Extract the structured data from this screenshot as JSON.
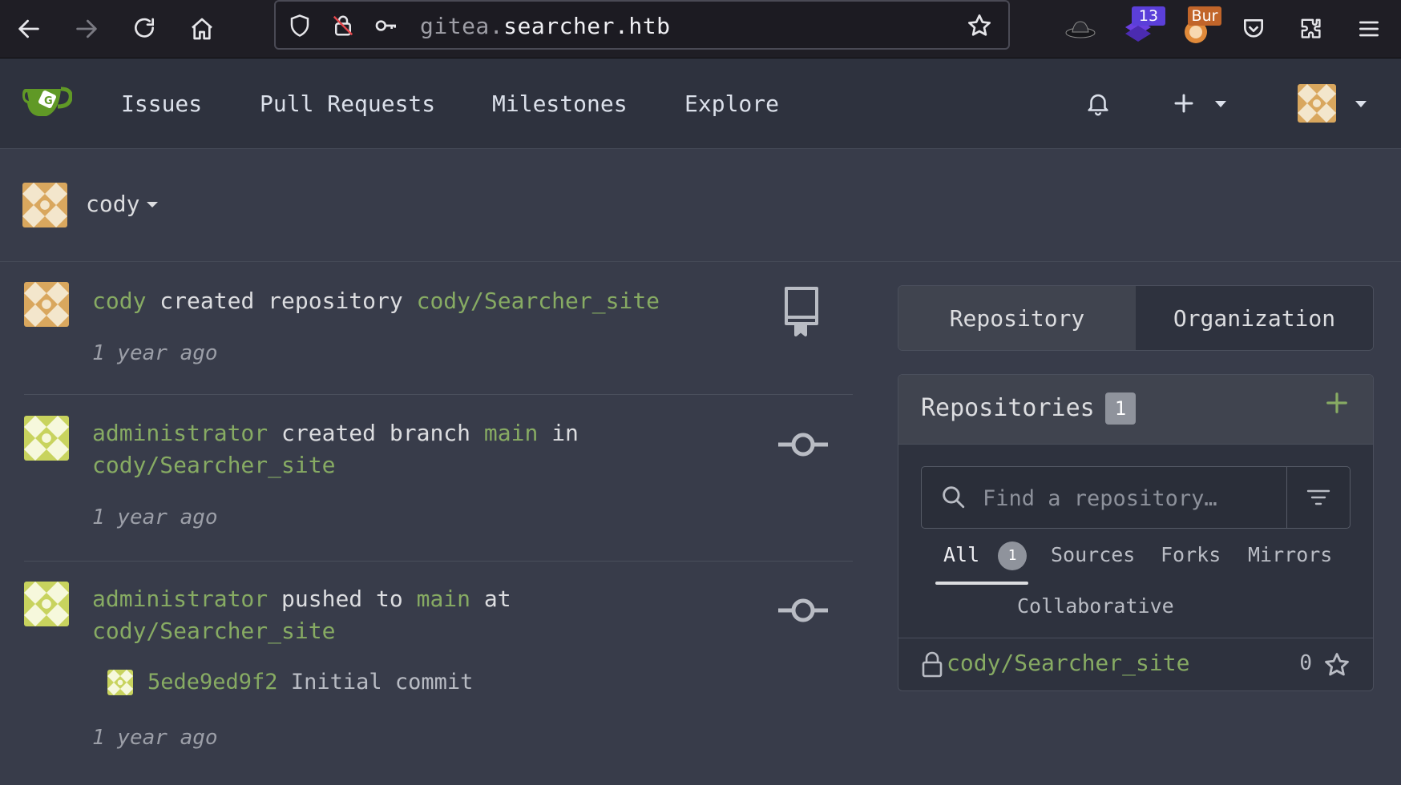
{
  "browser": {
    "url_subdomain": "gitea.",
    "url_host": "searcher.htb",
    "extensions": [
      {
        "name": "hat-icon"
      },
      {
        "name": "stack-extension-icon",
        "badge": "13"
      },
      {
        "name": "burp-extension-icon",
        "badge": "Bur"
      },
      {
        "name": "pocket-icon"
      },
      {
        "name": "extensions-icon"
      },
      {
        "name": "menu-icon"
      }
    ]
  },
  "header": {
    "nav": [
      "Issues",
      "Pull Requests",
      "Milestones",
      "Explore"
    ]
  },
  "context": {
    "user": "cody"
  },
  "feed": [
    {
      "actor": "cody",
      "action": "created repository",
      "target": "cody/Searcher_site",
      "time": "1 year ago",
      "icon": "repo-icon"
    },
    {
      "actor": "administrator",
      "action": "created branch",
      "branch": "main",
      "connector": "in",
      "target": "cody/Searcher_site",
      "time": "1 year ago",
      "icon": "commit-icon"
    },
    {
      "actor": "administrator",
      "action": "pushed to",
      "branch": "main",
      "connector": "at",
      "target": "cody/Searcher_site",
      "commit_sha": "5ede9ed9f2",
      "commit_message": "Initial commit",
      "time": "1 year ago",
      "icon": "commit-icon"
    }
  ],
  "sidebar": {
    "switcher": [
      "Repository",
      "Organization"
    ],
    "repositories_title": "Repositories",
    "repositories_count": "1",
    "search_placeholder": "Find a repository…",
    "tabs": [
      {
        "label": "All",
        "count": "1"
      },
      {
        "label": "Sources"
      },
      {
        "label": "Forks"
      },
      {
        "label": "Mirrors"
      },
      {
        "label": "Collaborative"
      }
    ],
    "repos": [
      {
        "name": "cody/Searcher_site",
        "stars": "0"
      }
    ]
  },
  "colors": {
    "link": "#87ab63",
    "background": "#383c4a",
    "header": "#2e323e"
  }
}
